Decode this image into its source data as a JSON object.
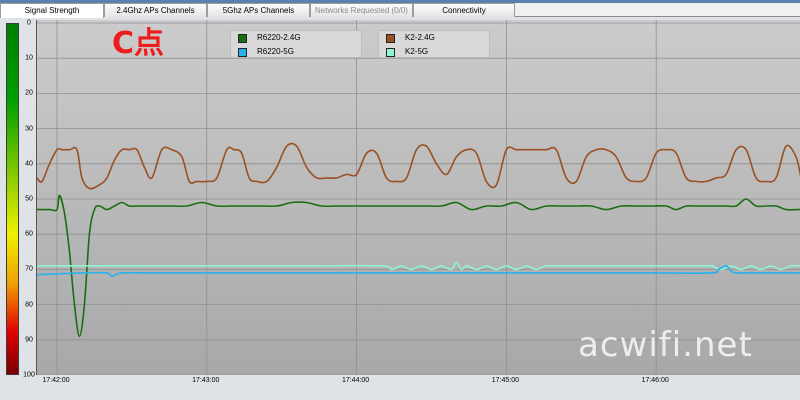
{
  "tabs": [
    {
      "label": "Signal Strength",
      "active": true,
      "disabled": false
    },
    {
      "label": "2.4Ghz APs Channels",
      "active": false,
      "disabled": false
    },
    {
      "label": "5Ghz APs Channels",
      "active": false,
      "disabled": false
    },
    {
      "label": "Networks Requested (0/0)",
      "active": false,
      "disabled": true
    },
    {
      "label": "Connectivity",
      "active": false,
      "disabled": false
    }
  ],
  "annotation": "C点",
  "watermark": "acwifi.net",
  "colors": {
    "R6220-2.4G": "#1a6e12",
    "R6220-5G": "#27b2ec",
    "K2-2.4G": "#9a5123",
    "K2-5G": "#8ef4d4"
  },
  "chart_data": {
    "type": "line",
    "title": "",
    "xlabel": "",
    "ylabel": "",
    "ylim": [
      0,
      100
    ],
    "y_inverted": true,
    "yticks": [
      0,
      10,
      20,
      30,
      40,
      50,
      60,
      70,
      80,
      90,
      100
    ],
    "xticks": [
      "17:42:00",
      "17:43:00",
      "17:44:00",
      "17:45:00",
      "17:46:00"
    ],
    "xlim_seconds": [
      -8,
      298
    ],
    "grid": true,
    "legend": [
      {
        "name": "R6220-2.4G"
      },
      {
        "name": "R6220-5G"
      },
      {
        "name": "K2-2.4G"
      },
      {
        "name": "K2-5G"
      }
    ],
    "series": [
      {
        "name": "K2-2.4G",
        "x": [
          -8,
          -6,
          -3,
          0,
          2,
          5,
          8,
          10,
          13,
          17,
          20,
          23,
          26,
          29,
          32,
          35,
          38,
          42,
          46,
          50,
          53,
          56,
          60,
          64,
          68,
          71,
          74,
          77,
          80,
          84,
          88,
          92,
          96,
          100,
          104,
          108,
          112,
          116,
          120,
          124,
          128,
          132,
          136,
          140,
          144,
          148,
          152,
          156,
          160,
          164,
          168,
          172,
          176,
          180,
          184,
          188,
          192,
          196,
          200,
          204,
          208,
          212,
          216,
          220,
          224,
          228,
          232,
          236,
          240,
          244,
          248,
          252,
          256,
          260,
          264,
          268,
          272,
          276,
          280,
          284,
          288,
          292,
          296,
          298
        ],
        "values": [
          44,
          45,
          40,
          36,
          36,
          36,
          36,
          44,
          47,
          46,
          44,
          39,
          36,
          36,
          36,
          41,
          44,
          36,
          36,
          38,
          45,
          45,
          45,
          44,
          36,
          36,
          37,
          44,
          45,
          45,
          41,
          35,
          35,
          41,
          44,
          44,
          44,
          43,
          43,
          37,
          37,
          44,
          45,
          44,
          36,
          35,
          40,
          43,
          38,
          36,
          37,
          45,
          46,
          36,
          36,
          36,
          36,
          36,
          36,
          44,
          45,
          38,
          36,
          36,
          38,
          44,
          45,
          44,
          37,
          36,
          37,
          44,
          45,
          45,
          44,
          43,
          36,
          36,
          44,
          45,
          44,
          35,
          38,
          44
        ]
      },
      {
        "name": "R6220-2.4G",
        "x": [
          -8,
          -3,
          0,
          1,
          3,
          5,
          7,
          9,
          11,
          13,
          15,
          17,
          20,
          23,
          26,
          29,
          32,
          36,
          40,
          46,
          52,
          58,
          64,
          70,
          76,
          82,
          88,
          94,
          100,
          106,
          112,
          118,
          124,
          130,
          136,
          142,
          148,
          154,
          160,
          166,
          172,
          178,
          184,
          190,
          196,
          202,
          208,
          214,
          220,
          226,
          232,
          238,
          244,
          248,
          252,
          256,
          260,
          264,
          268,
          272,
          276,
          280,
          284,
          288,
          292,
          296,
          298
        ],
        "values": [
          53,
          53,
          53,
          49,
          54,
          65,
          80,
          89,
          80,
          60,
          53,
          52,
          53,
          52,
          51,
          52,
          52,
          52,
          52,
          52,
          52,
          51,
          52,
          52,
          52,
          52,
          52,
          51,
          51,
          52,
          52,
          52,
          52,
          52,
          52,
          52,
          52,
          52,
          51,
          53,
          52,
          52,
          51,
          53,
          52,
          52,
          52,
          52,
          53,
          52,
          52,
          52,
          52,
          53,
          52,
          52,
          52,
          52,
          52,
          52,
          50,
          52,
          52,
          52,
          53,
          53,
          53
        ]
      },
      {
        "name": "K2-5G",
        "x": [
          -8,
          20,
          60,
          100,
          130,
          134,
          138,
          142,
          146,
          150,
          154,
          158,
          160,
          162,
          164,
          168,
          172,
          176,
          180,
          184,
          188,
          192,
          196,
          200,
          230,
          260,
          262,
          266,
          270,
          274,
          278,
          282,
          286,
          290,
          294,
          298
        ],
        "values": [
          69,
          69,
          69,
          69,
          69,
          70,
          69,
          70,
          69,
          70,
          69,
          70,
          68,
          70,
          69,
          70,
          69,
          70,
          69,
          70,
          69,
          70,
          69,
          69,
          69,
          69,
          69,
          70,
          69,
          70,
          69,
          70,
          69,
          70,
          69,
          69
        ]
      },
      {
        "name": "R6220-5G",
        "x": [
          -8,
          10,
          20,
          22,
          26,
          40,
          100,
          160,
          200,
          240,
          262,
          265,
          268,
          270,
          272,
          275,
          278,
          298
        ],
        "values": [
          71.5,
          71,
          71,
          72,
          71,
          71,
          71,
          71,
          71,
          71,
          71,
          70,
          69,
          70.5,
          71,
          71,
          71,
          71
        ]
      }
    ]
  }
}
